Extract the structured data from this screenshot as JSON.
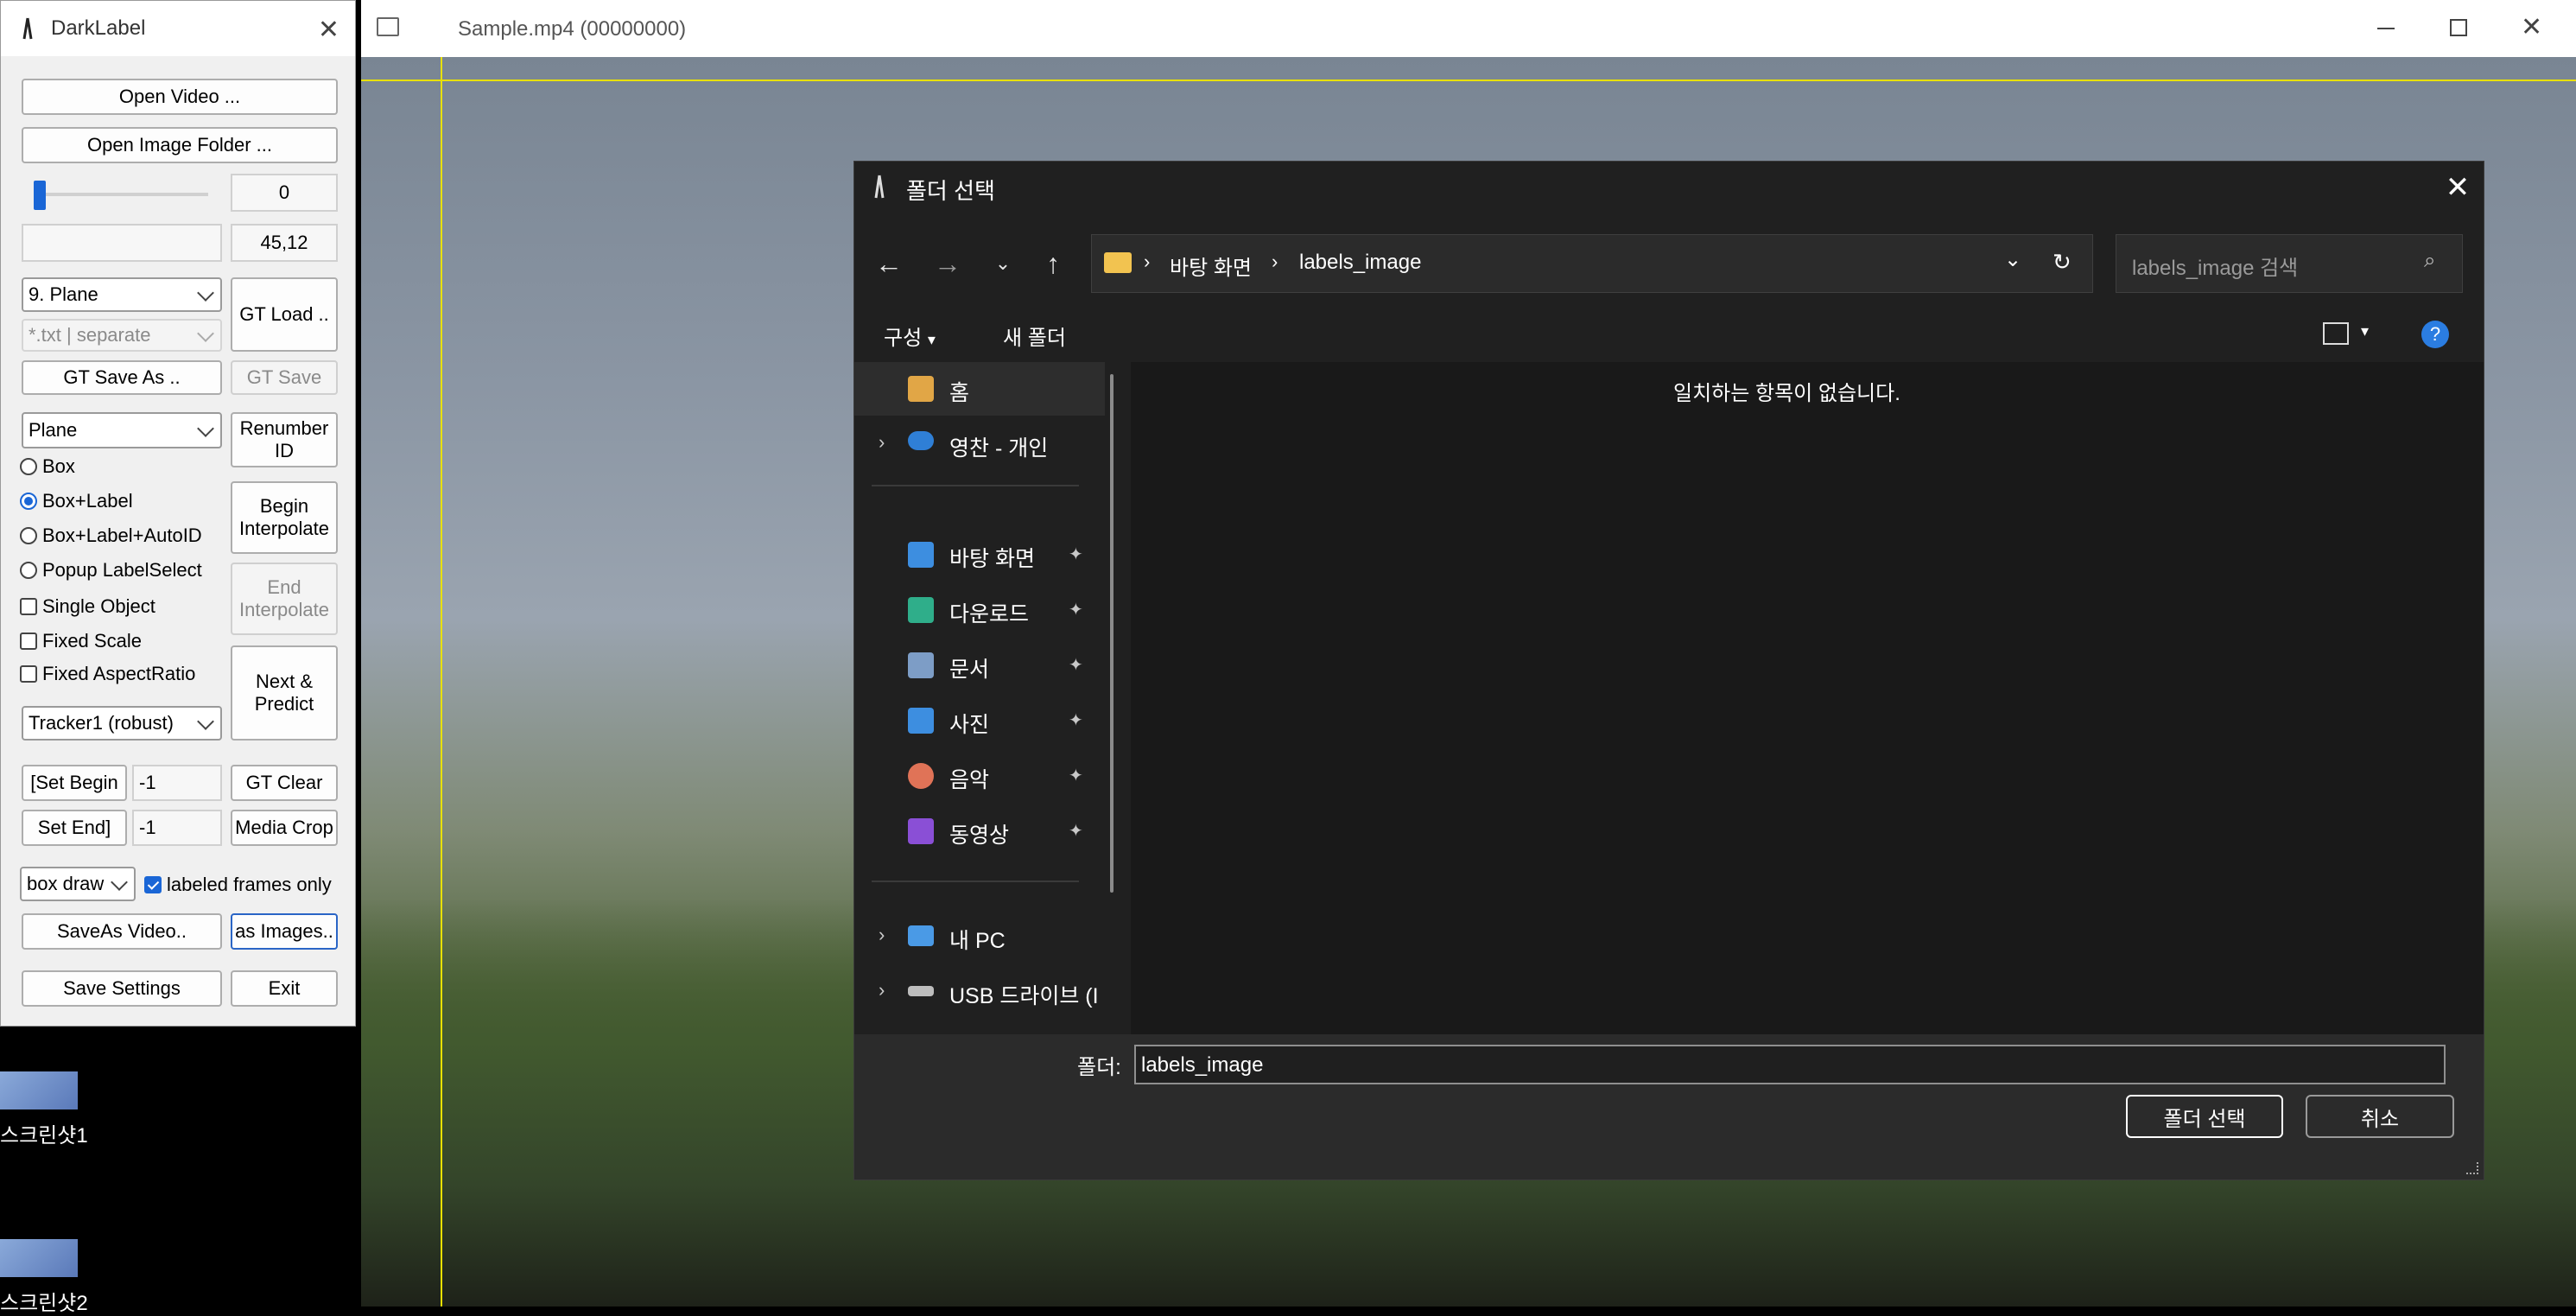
{
  "darklabel": {
    "title": "DarkLabel",
    "open_video": "Open Video ...",
    "open_image_folder": "Open Image Folder ...",
    "frame_value": "0",
    "coords": "45,12",
    "class_preset": "9. Plane",
    "format": "*.txt | separate",
    "gt_load": "GT Load ..",
    "gt_save_as": "GT Save As ..",
    "gt_save": "GT Save",
    "class_label": "Plane",
    "renumber_id": "Renumber ID",
    "modes": [
      "Box",
      "Box+Label",
      "Box+Label+AutoID",
      "Popup LabelSelect"
    ],
    "selected_mode": "Box+Label",
    "begin_interpolate": "Begin Interpolate",
    "end_interpolate": "End Interpolate",
    "checks": [
      {
        "label": "Single Object",
        "checked": false
      },
      {
        "label": "Fixed Scale",
        "checked": false
      },
      {
        "label": "Fixed AspectRatio",
        "checked": false
      }
    ],
    "next_predict": "Next & Predict",
    "tracker": "Tracker1 (robust)",
    "set_begin": "[Set Begin",
    "set_begin_value": "-1",
    "set_end": "Set End]",
    "set_end_value": "-1",
    "gt_clear": "GT Clear",
    "media_crop": "Media Crop",
    "draw_mode": "box draw",
    "labeled_frames_only": "labeled frames only",
    "labeled_frames_checked": true,
    "save_as_video": "SaveAs Video..",
    "as_images": "as Images..",
    "save_settings": "Save Settings",
    "exit": "Exit"
  },
  "desktop": {
    "icons": [
      "스크린샷1",
      "스크린샷2"
    ]
  },
  "video_window": {
    "title": "Sample.mp4 (00000000)"
  },
  "dialog": {
    "title": "폴더 선택",
    "breadcrumb": [
      "바탕 화면",
      "labels_image"
    ],
    "search_placeholder": "labels_image 검색",
    "organize": "구성",
    "new_folder": "새 폴더",
    "empty_message": "일치하는 항목이 없습니다.",
    "nav_items": [
      {
        "label": "홈",
        "icon": "home-icon",
        "pinned": false,
        "expandable": false
      },
      {
        "label": "영찬 - 개인",
        "icon": "onedrive-icon",
        "pinned": false,
        "expandable": true
      },
      {
        "label": "바탕 화면",
        "icon": "desktop-icon",
        "pinned": true,
        "expandable": false
      },
      {
        "label": "다운로드",
        "icon": "download-icon",
        "pinned": true,
        "expandable": false
      },
      {
        "label": "문서",
        "icon": "document-icon",
        "pinned": true,
        "expandable": false
      },
      {
        "label": "사진",
        "icon": "picture-icon",
        "pinned": true,
        "expandable": false
      },
      {
        "label": "음악",
        "icon": "music-icon",
        "pinned": true,
        "expandable": false
      },
      {
        "label": "동영상",
        "icon": "video-icon",
        "pinned": true,
        "expandable": false
      },
      {
        "label": "내 PC",
        "icon": "pc-icon",
        "pinned": false,
        "expandable": true
      },
      {
        "label": "USB 드라이브 (I",
        "icon": "usb-drive-icon",
        "pinned": false,
        "expandable": true
      }
    ],
    "folder_label": "폴더:",
    "folder_value": "labels_image",
    "select_button": "폴더 선택",
    "cancel_button": "취소"
  },
  "colors": {
    "accent": "#1a66d6",
    "yellow_guide": "#e8e000",
    "dialog_bg": "#202020"
  }
}
